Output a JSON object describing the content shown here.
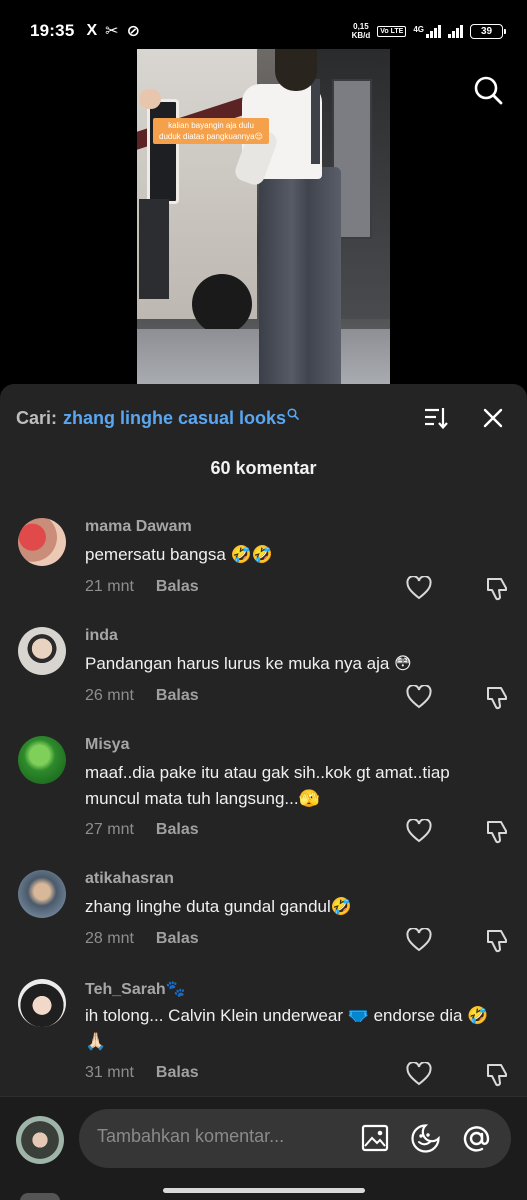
{
  "status_bar": {
    "time": "19:35",
    "app_icons": [
      "X",
      "✂",
      "⊘"
    ],
    "net_speed_value": "0,15",
    "net_speed_unit": "KB/d",
    "volte": "Vo LTE",
    "network": "4G",
    "battery": "39"
  },
  "video": {
    "caption": "kalian bayangin aja dulu duduk diatas pangkuannya😌"
  },
  "comments_sheet": {
    "search_label": "Cari:",
    "search_term": "zhang linghe casual looks",
    "count_label": "60 komentar",
    "reply_label": "Balas",
    "comments": [
      {
        "user": "mama Dawam",
        "text": "pemersatu bangsa 🤣🤣",
        "time": "21 mnt"
      },
      {
        "user": "inda",
        "text": "Pandangan harus lurus ke muka nya aja 😳",
        "time": "26 mnt"
      },
      {
        "user": "Misya",
        "text": "maaf..dia pake itu atau gak sih..kok gt amat..tiap muncul mata tuh langsung...🫣",
        "time": "27 mnt"
      },
      {
        "user": "atikahasran",
        "text": "zhang linghe duta gundal gandul🤣",
        "time": "28 mnt"
      },
      {
        "user": "Teh_Sarah🐾",
        "text": "ih tolong... Calvin Klein underwear 🩲 endorse dia 🤣🙏🏻",
        "time": "31 mnt"
      }
    ]
  },
  "composer": {
    "placeholder": "Tambahkan komentar..."
  },
  "colors": {
    "sheet_bg": "#242424",
    "search_link": "#5aa6f0",
    "caption_bg": "#f5a14b"
  }
}
